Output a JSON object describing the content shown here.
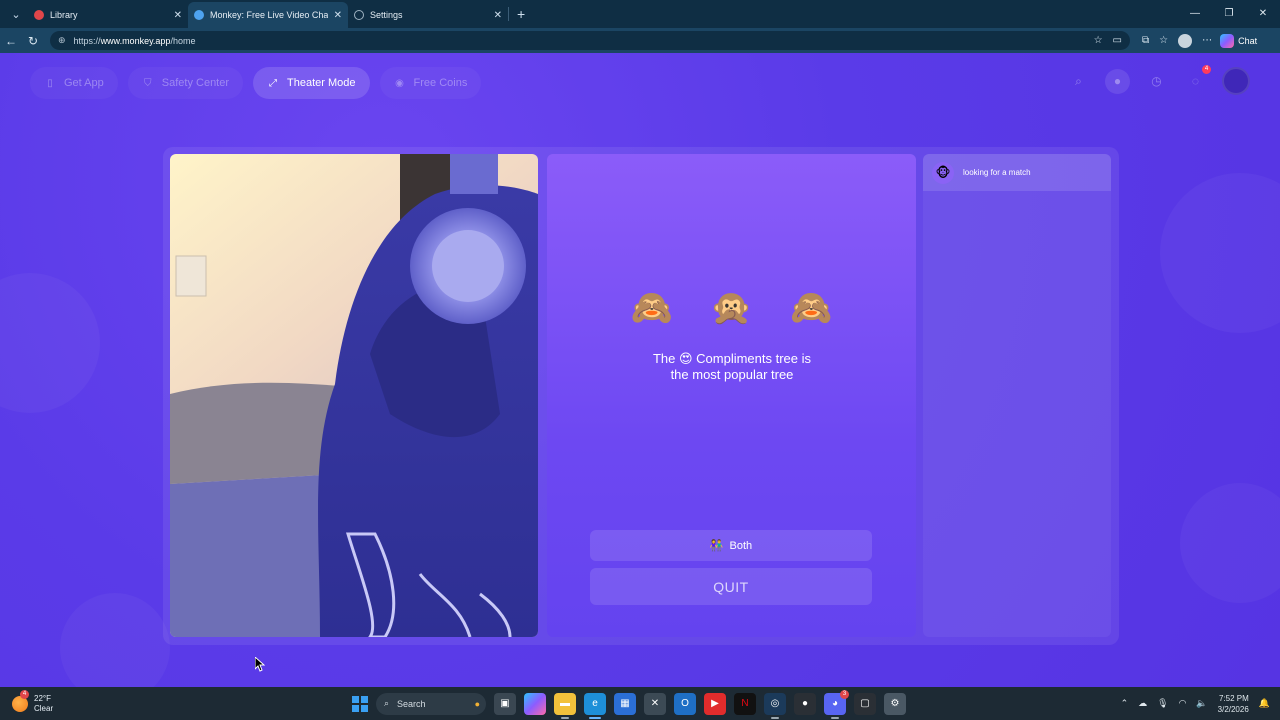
{
  "browser": {
    "tabs": [
      {
        "label": "Library",
        "icon_color": "#e0464a",
        "active": false
      },
      {
        "label": "Monkey: Free Live Video Chat",
        "icon_color": "#4ea3f0",
        "active": true
      },
      {
        "label": "Settings",
        "icon_color": "#9fb3c2",
        "active": false
      }
    ],
    "url_prefix": "https://",
    "url_host": "www.monkey.app",
    "url_path": "/home",
    "chat_label": "Chat"
  },
  "nav": {
    "get_app": "Get App",
    "safety_center": "Safety Center",
    "theater_mode": "Theater Mode",
    "free_coins": "Free Coins",
    "notification_count": "4"
  },
  "center": {
    "monkeys": "🙈 🙊 🙈",
    "tip_line1": "The 😍 Compliments tree is",
    "tip_line2": "the most popular tree",
    "both_icon": "👫",
    "both_label": "Both",
    "quit_label": "QUIT"
  },
  "side": {
    "status": "looking for a match",
    "icon": "🐵"
  },
  "taskbar": {
    "temp": "22°F",
    "condition": "Clear",
    "weather_badge": "4",
    "search_label": "Search",
    "time": "7:52 PM",
    "date": "3/2/2026",
    "discord_badge": "3"
  },
  "colors": {
    "page_bg": "#5a3be8",
    "accent": "#8b5cf9"
  }
}
